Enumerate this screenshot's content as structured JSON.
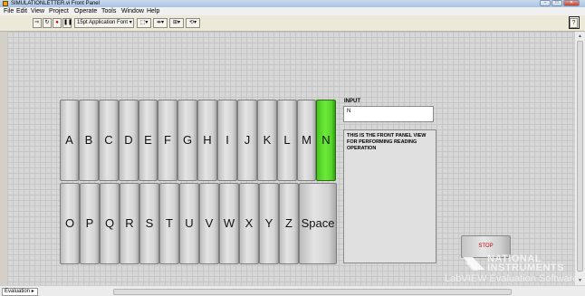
{
  "window": {
    "title": "SIMULATIONLETTER.vi Front Panel"
  },
  "menu": [
    "File",
    "Edit",
    "View",
    "Project",
    "Operate",
    "Tools",
    "Window",
    "Help"
  ],
  "toolbar": {
    "font_selector": "15pt Application Font"
  },
  "keys": {
    "row1": [
      "A",
      "B",
      "C",
      "D",
      "E",
      "F",
      "G",
      "H",
      "I",
      "J",
      "K",
      "L",
      "M",
      "N"
    ],
    "row2": [
      "O",
      "P",
      "Q",
      "R",
      "S",
      "T",
      "U",
      "V",
      "W",
      "X",
      "Y",
      "Z",
      "Space"
    ],
    "active_key": "N"
  },
  "input": {
    "label": "INPUT",
    "value": "N"
  },
  "message": "THIS IS THE FRONT PANEL VIEW FOR PERFORMING READING OPERATION",
  "stop_button": {
    "label": "STOP"
  },
  "branding": {
    "line1": "NATIONAL",
    "line2": "INSTRUMENTS",
    "watermark": "LabVIEW  Evaluation Software"
  },
  "status": {
    "tab": "Evaluation"
  },
  "colors": {
    "active_key": "#5cd92b",
    "stop_text": "#cc0000",
    "panel_grid": "#d7d7d7"
  }
}
